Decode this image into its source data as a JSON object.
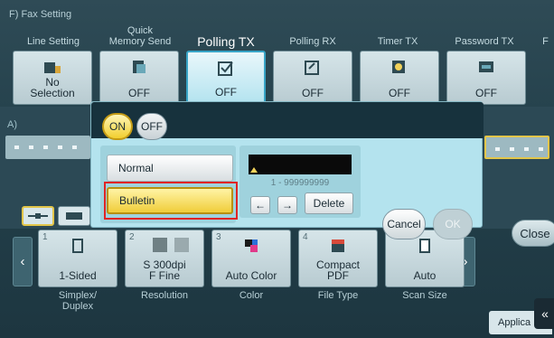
{
  "header": {
    "title": "F)  Fax Setting"
  },
  "tabs": [
    {
      "label": "Line Setting"
    },
    {
      "label": "Quick\nMemory Send"
    },
    {
      "label": "Polling TX"
    },
    {
      "label": "Polling RX"
    },
    {
      "label": "Timer TX"
    },
    {
      "label": "Password TX"
    },
    {
      "label": "F"
    }
  ],
  "function_buttons": [
    {
      "label": "No\nSelection",
      "icon": "line-setting-icon"
    },
    {
      "label": "OFF",
      "icon": "quick-memory-send-icon"
    },
    {
      "label": "OFF",
      "icon": "polling-tx-icon"
    },
    {
      "label": "OFF",
      "icon": "polling-rx-icon"
    },
    {
      "label": "OFF",
      "icon": "timer-tx-icon"
    },
    {
      "label": "OFF",
      "icon": "password-tx-icon"
    }
  ],
  "band_label": "A)",
  "dialog": {
    "toggle_on": "ON",
    "toggle_off": "OFF",
    "options": [
      "Normal",
      "Bulletin"
    ],
    "selected_option": "Bulletin",
    "range": "1 - 999999999",
    "left_arrow": "←",
    "right_arrow": "→",
    "delete_label": "Delete",
    "cancel_label": "Cancel",
    "ok_label": "OK"
  },
  "close_label": "Close",
  "bottom_buttons": [
    {
      "num": "1",
      "label": "1-Sided",
      "caption": "Simplex/\nDuplex"
    },
    {
      "num": "2",
      "label": "S 300dpi\nF Fine",
      "caption": "Resolution"
    },
    {
      "num": "3",
      "label": "Auto Color",
      "caption": "Color"
    },
    {
      "num": "4",
      "label": "Compact\nPDF",
      "caption": "File Type"
    },
    {
      "num": "",
      "label": "Auto",
      "caption": "Scan Size"
    }
  ],
  "applica_label": "Applica",
  "colors": {
    "accent": "#38a4c6",
    "selected_yellow": "#f0cd3a",
    "highlight_red": "#e02424"
  }
}
